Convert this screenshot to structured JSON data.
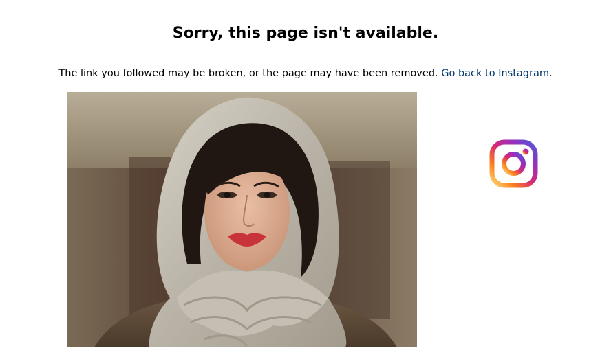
{
  "page": {
    "heading": "Sorry, this page isn't available.",
    "message": "The link you followed may be broken, or the page may have been removed.",
    "back_link": "Go back to Instagram",
    "back_link_suffix": "."
  },
  "icons": {
    "logo": "instagram-logo-icon"
  },
  "colors": {
    "link": "#00376b",
    "text": "#000000",
    "background": "#ffffff"
  }
}
